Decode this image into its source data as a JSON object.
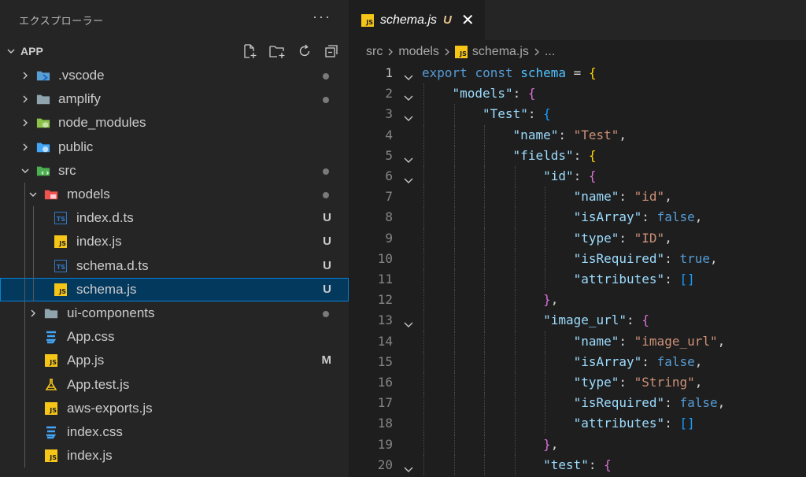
{
  "sidebar": {
    "title": "エクスプローラー",
    "more": "···",
    "project": "APP",
    "items": [
      {
        "label": ".vscode",
        "depth": 0,
        "kind": "folder",
        "icon": "vscode-folder-icon",
        "expanded": false,
        "status": "dot"
      },
      {
        "label": "amplify",
        "depth": 0,
        "kind": "folder",
        "icon": "folder-icon",
        "expanded": false,
        "status": "dot"
      },
      {
        "label": "node_modules",
        "depth": 0,
        "kind": "folder",
        "icon": "node-folder-icon",
        "expanded": false,
        "status": ""
      },
      {
        "label": "public",
        "depth": 0,
        "kind": "folder",
        "icon": "public-folder-icon",
        "expanded": false,
        "status": ""
      },
      {
        "label": "src",
        "depth": 0,
        "kind": "folder",
        "icon": "src-folder-icon",
        "expanded": true,
        "status": "dot"
      },
      {
        "label": "models",
        "depth": 1,
        "kind": "folder",
        "icon": "models-folder-icon",
        "expanded": true,
        "status": "dot"
      },
      {
        "label": "index.d.ts",
        "depth": 2,
        "kind": "ts",
        "icon": "typescript-icon",
        "status": "U"
      },
      {
        "label": "index.js",
        "depth": 2,
        "kind": "js",
        "icon": "javascript-icon",
        "status": "U"
      },
      {
        "label": "schema.d.ts",
        "depth": 2,
        "kind": "ts",
        "icon": "typescript-icon",
        "status": "U"
      },
      {
        "label": "schema.js",
        "depth": 2,
        "kind": "js",
        "icon": "javascript-icon",
        "status": "U",
        "selected": true
      },
      {
        "label": "ui-components",
        "depth": 1,
        "kind": "folder",
        "icon": "folder-icon",
        "expanded": false,
        "status": "dot"
      },
      {
        "label": "App.css",
        "depth": 1,
        "kind": "css",
        "icon": "css-icon",
        "status": ""
      },
      {
        "label": "App.js",
        "depth": 1,
        "kind": "js",
        "icon": "javascript-icon",
        "status": "M"
      },
      {
        "label": "App.test.js",
        "depth": 1,
        "kind": "test",
        "icon": "flask-icon",
        "status": ""
      },
      {
        "label": "aws-exports.js",
        "depth": 1,
        "kind": "js",
        "icon": "javascript-icon",
        "status": ""
      },
      {
        "label": "index.css",
        "depth": 1,
        "kind": "css",
        "icon": "css-icon",
        "status": ""
      },
      {
        "label": "index.js",
        "depth": 1,
        "kind": "js",
        "icon": "javascript-icon",
        "status": ""
      }
    ]
  },
  "editor": {
    "tab": {
      "label": "schema.js",
      "status": "U"
    },
    "breadcrumb": {
      "parts": [
        "src",
        "models"
      ],
      "file": "schema.js",
      "tail": "..."
    },
    "lines": [
      {
        "n": "1",
        "fold": true,
        "indent": 0,
        "tokens": [
          [
            "kw",
            "export"
          ],
          [
            "op",
            " "
          ],
          [
            "kw",
            "const"
          ],
          [
            "op",
            " "
          ],
          [
            "var",
            "schema"
          ],
          [
            "op",
            " = "
          ],
          [
            "brace1",
            "{"
          ]
        ]
      },
      {
        "n": "2",
        "fold": true,
        "indent": 1,
        "tokens": [
          [
            "key",
            "\"models\""
          ],
          [
            "punc",
            ": "
          ],
          [
            "brace2",
            "{"
          ]
        ]
      },
      {
        "n": "3",
        "fold": true,
        "indent": 2,
        "tokens": [
          [
            "key",
            "\"Test\""
          ],
          [
            "punc",
            ": "
          ],
          [
            "brace3",
            "{"
          ]
        ]
      },
      {
        "n": "4",
        "fold": false,
        "indent": 3,
        "tokens": [
          [
            "key",
            "\"name\""
          ],
          [
            "punc",
            ": "
          ],
          [
            "str",
            "\"Test\""
          ],
          [
            "punc",
            ","
          ]
        ]
      },
      {
        "n": "5",
        "fold": true,
        "indent": 3,
        "tokens": [
          [
            "key",
            "\"fields\""
          ],
          [
            "punc",
            ": "
          ],
          [
            "brace1",
            "{"
          ]
        ]
      },
      {
        "n": "6",
        "fold": true,
        "indent": 4,
        "tokens": [
          [
            "key",
            "\"id\""
          ],
          [
            "punc",
            ": "
          ],
          [
            "brace2",
            "{"
          ]
        ]
      },
      {
        "n": "7",
        "fold": false,
        "indent": 5,
        "tokens": [
          [
            "key",
            "\"name\""
          ],
          [
            "punc",
            ": "
          ],
          [
            "str",
            "\"id\""
          ],
          [
            "punc",
            ","
          ]
        ]
      },
      {
        "n": "8",
        "fold": false,
        "indent": 5,
        "tokens": [
          [
            "key",
            "\"isArray\""
          ],
          [
            "punc",
            ": "
          ],
          [
            "bool",
            "false"
          ],
          [
            "punc",
            ","
          ]
        ]
      },
      {
        "n": "9",
        "fold": false,
        "indent": 5,
        "tokens": [
          [
            "key",
            "\"type\""
          ],
          [
            "punc",
            ": "
          ],
          [
            "str",
            "\"ID\""
          ],
          [
            "punc",
            ","
          ]
        ]
      },
      {
        "n": "10",
        "fold": false,
        "indent": 5,
        "tokens": [
          [
            "key",
            "\"isRequired\""
          ],
          [
            "punc",
            ": "
          ],
          [
            "bool",
            "true"
          ],
          [
            "punc",
            ","
          ]
        ]
      },
      {
        "n": "11",
        "fold": false,
        "indent": 5,
        "tokens": [
          [
            "key",
            "\"attributes\""
          ],
          [
            "punc",
            ": "
          ],
          [
            "brace3",
            "[]"
          ]
        ]
      },
      {
        "n": "12",
        "fold": false,
        "indent": 4,
        "tokens": [
          [
            "brace2",
            "}"
          ],
          [
            "punc",
            ","
          ]
        ]
      },
      {
        "n": "13",
        "fold": true,
        "indent": 4,
        "tokens": [
          [
            "key",
            "\"image_url\""
          ],
          [
            "punc",
            ": "
          ],
          [
            "brace2",
            "{"
          ]
        ]
      },
      {
        "n": "14",
        "fold": false,
        "indent": 5,
        "tokens": [
          [
            "key",
            "\"name\""
          ],
          [
            "punc",
            ": "
          ],
          [
            "str",
            "\"image_url\""
          ],
          [
            "punc",
            ","
          ]
        ]
      },
      {
        "n": "15",
        "fold": false,
        "indent": 5,
        "tokens": [
          [
            "key",
            "\"isArray\""
          ],
          [
            "punc",
            ": "
          ],
          [
            "bool",
            "false"
          ],
          [
            "punc",
            ","
          ]
        ]
      },
      {
        "n": "16",
        "fold": false,
        "indent": 5,
        "tokens": [
          [
            "key",
            "\"type\""
          ],
          [
            "punc",
            ": "
          ],
          [
            "str",
            "\"String\""
          ],
          [
            "punc",
            ","
          ]
        ]
      },
      {
        "n": "17",
        "fold": false,
        "indent": 5,
        "tokens": [
          [
            "key",
            "\"isRequired\""
          ],
          [
            "punc",
            ": "
          ],
          [
            "bool",
            "false"
          ],
          [
            "punc",
            ","
          ]
        ]
      },
      {
        "n": "18",
        "fold": false,
        "indent": 5,
        "tokens": [
          [
            "key",
            "\"attributes\""
          ],
          [
            "punc",
            ": "
          ],
          [
            "brace3",
            "[]"
          ]
        ]
      },
      {
        "n": "19",
        "fold": false,
        "indent": 4,
        "tokens": [
          [
            "brace2",
            "}"
          ],
          [
            "punc",
            ","
          ]
        ]
      },
      {
        "n": "20",
        "fold": true,
        "indent": 4,
        "tokens": [
          [
            "key",
            "\"test\""
          ],
          [
            "punc",
            ": "
          ],
          [
            "brace2",
            "{"
          ]
        ]
      }
    ],
    "active_line": "1"
  }
}
